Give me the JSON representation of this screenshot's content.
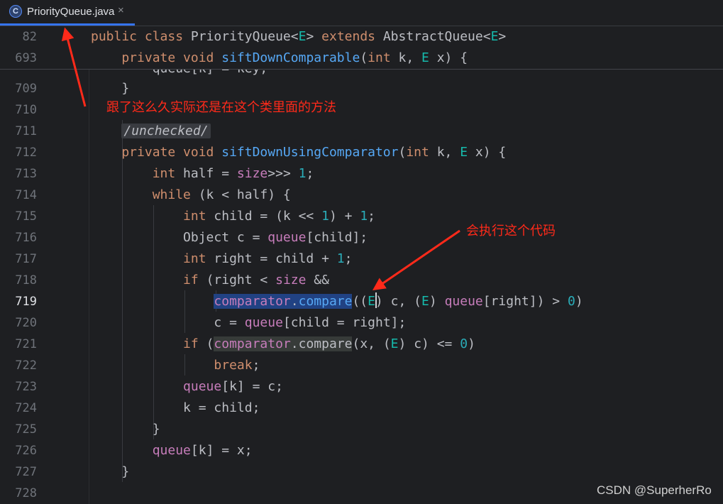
{
  "tab": {
    "icon": "C",
    "file_name": "PriorityQueue.java",
    "close": "×"
  },
  "sticky": [
    {
      "num": "82",
      "parts": [
        [
          "kw",
          "public class "
        ],
        [
          "",
          "PriorityQueue<"
        ],
        [
          "tp",
          "E"
        ],
        [
          "",
          "> "
        ],
        [
          "kw",
          "extends "
        ],
        [
          "",
          "AbstractQueue<"
        ],
        [
          "tp",
          "E"
        ],
        [
          "",
          ">"
        ]
      ]
    },
    {
      "num": "693",
      "parts": [
        [
          "kw",
          "    private void "
        ],
        [
          "fn",
          "siftDownComparable"
        ],
        [
          "",
          "("
        ],
        [
          "kw",
          "int "
        ],
        [
          "",
          "k, "
        ],
        [
          "tp",
          "E "
        ],
        [
          "",
          "x) {"
        ]
      ]
    }
  ],
  "cut_line": "        queue[k] = key;",
  "lines": [
    {
      "num": "709",
      "parts": [
        [
          "",
          "    }"
        ]
      ]
    },
    {
      "num": "710",
      "parts": []
    },
    {
      "num": "711",
      "parts": [
        [
          "",
          "    "
        ],
        [
          "ann",
          "/unchecked/"
        ]
      ]
    },
    {
      "num": "712",
      "parts": [
        [
          "kw",
          "    private void "
        ],
        [
          "fn",
          "siftDownUsingComparator"
        ],
        [
          "",
          "("
        ],
        [
          "kw",
          "int "
        ],
        [
          "",
          "k, "
        ],
        [
          "tp",
          "E "
        ],
        [
          "",
          "x) {"
        ]
      ]
    },
    {
      "num": "713",
      "parts": [
        [
          "kw",
          "        int "
        ],
        [
          "",
          "half = "
        ],
        [
          "fld",
          "size"
        ],
        [
          "",
          ">>> "
        ],
        [
          "num",
          "1"
        ],
        [
          "",
          ";"
        ]
      ]
    },
    {
      "num": "714",
      "parts": [
        [
          "kw",
          "        while "
        ],
        [
          "",
          "(k < half) {"
        ]
      ]
    },
    {
      "num": "715",
      "parts": [
        [
          "kw",
          "            int "
        ],
        [
          "",
          "child = (k << "
        ],
        [
          "num",
          "1"
        ],
        [
          "",
          ") + "
        ],
        [
          "num",
          "1"
        ],
        [
          "",
          ";"
        ]
      ]
    },
    {
      "num": "716",
      "parts": [
        [
          "",
          "            Object c = "
        ],
        [
          "fld",
          "queue"
        ],
        [
          "",
          "[child];"
        ]
      ]
    },
    {
      "num": "717",
      "parts": [
        [
          "kw",
          "            int "
        ],
        [
          "",
          "right = child + "
        ],
        [
          "num",
          "1"
        ],
        [
          "",
          ";"
        ]
      ]
    },
    {
      "num": "718",
      "parts": [
        [
          "kw",
          "            if "
        ],
        [
          "",
          "(right < "
        ],
        [
          "fld",
          "size "
        ],
        [
          "",
          "&&"
        ]
      ]
    },
    {
      "num": "719",
      "current": true,
      "parts": [
        [
          "",
          "                "
        ],
        [
          "sel fld",
          "comparator"
        ],
        [
          "sel",
          "."
        ],
        [
          "sel fn",
          "compare"
        ],
        [
          "",
          "(("
        ],
        [
          "tp",
          "E"
        ],
        [
          "",
          ") c, ("
        ],
        [
          "tp",
          "E"
        ],
        [
          "",
          ") "
        ],
        [
          "fld",
          "queue"
        ],
        [
          "",
          "[right]) > "
        ],
        [
          "num",
          "0"
        ],
        [
          "",
          ")"
        ]
      ]
    },
    {
      "num": "720",
      "parts": [
        [
          "",
          "                c = "
        ],
        [
          "fld",
          "queue"
        ],
        [
          "",
          "[child = right];"
        ]
      ]
    },
    {
      "num": "721",
      "parts": [
        [
          "kw",
          "            if "
        ],
        [
          "",
          "("
        ],
        [
          "hl fld",
          "comparator"
        ],
        [
          "hl",
          ".compare"
        ],
        [
          "",
          "(x, ("
        ],
        [
          "tp",
          "E"
        ],
        [
          "",
          ") c) <= "
        ],
        [
          "num",
          "0"
        ],
        [
          "",
          ")"
        ]
      ]
    },
    {
      "num": "722",
      "parts": [
        [
          "kw",
          "                break"
        ],
        [
          "",
          ";"
        ]
      ]
    },
    {
      "num": "723",
      "parts": [
        [
          "",
          "            "
        ],
        [
          "fld",
          "queue"
        ],
        [
          "",
          "[k] = c;"
        ]
      ]
    },
    {
      "num": "724",
      "parts": [
        [
          "",
          "            k = child;"
        ]
      ]
    },
    {
      "num": "725",
      "parts": [
        [
          "",
          "        }"
        ]
      ]
    },
    {
      "num": "726",
      "parts": [
        [
          "",
          "        "
        ],
        [
          "fld",
          "queue"
        ],
        [
          "",
          "[k] = x;"
        ]
      ]
    },
    {
      "num": "727",
      "parts": [
        [
          "",
          "    }"
        ]
      ]
    },
    {
      "num": "728",
      "parts": []
    }
  ],
  "annotations": {
    "note_top": "跟了这么久实际还是在这个类里面的方法",
    "note_mid": "会执行这个代码",
    "arrow_color": "#ff2a1a"
  },
  "watermark": "CSDN @SuperherRo"
}
